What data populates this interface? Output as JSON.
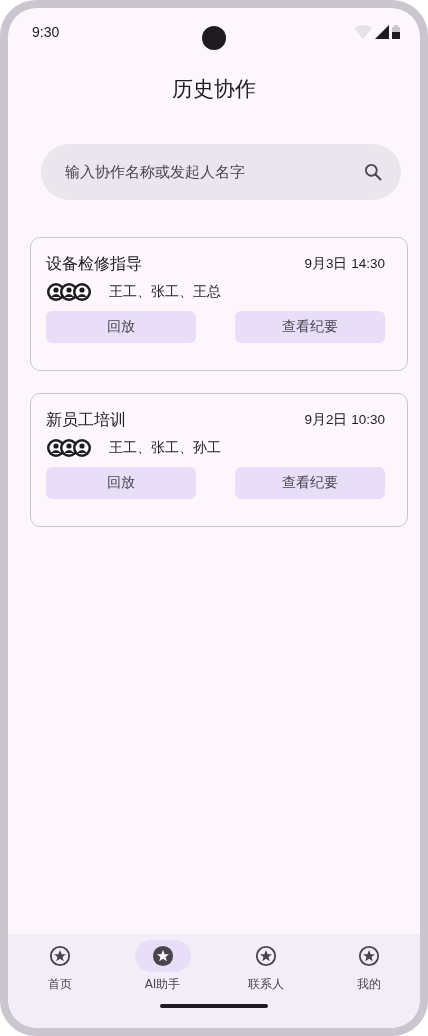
{
  "status_bar": {
    "time": "9:30"
  },
  "title": "历史协作",
  "search": {
    "placeholder": "输入协作名称或发起人名字"
  },
  "sessions": [
    {
      "name": "设备检修指导",
      "time": "9月3日 14:30",
      "participants": "王工、张工、王总",
      "actions": [
        "回放",
        "查看纪要"
      ]
    },
    {
      "name": "新员工培训",
      "time": "9月2日 10:30",
      "participants": "王工、张工、孙工",
      "actions": [
        "回放",
        "查看纪要"
      ]
    }
  ],
  "nav": [
    {
      "label": "首页",
      "selected": false
    },
    {
      "label": "AI助手",
      "selected": true
    },
    {
      "label": "联系人",
      "selected": false
    },
    {
      "label": "我的",
      "selected": false
    }
  ]
}
